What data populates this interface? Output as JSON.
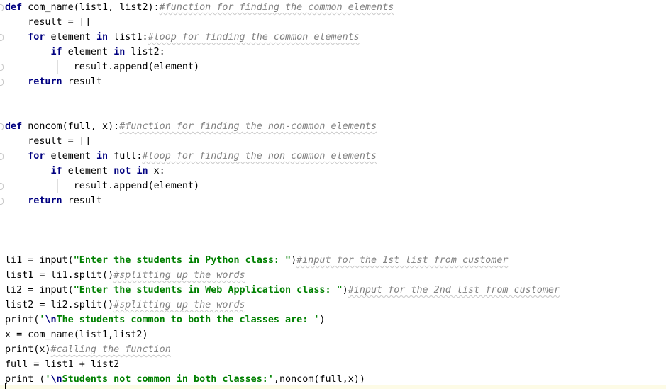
{
  "editor": {
    "language": "python",
    "colors": {
      "keyword": "#000080",
      "string": "#008000",
      "comment": "#808080",
      "text": "#000000",
      "current_line": "#fdfbe6"
    },
    "lines": [
      {
        "indent": 0,
        "tokens": [
          {
            "t": "kw",
            "v": "def"
          },
          {
            "t": "plain",
            "v": " com_name(list1, list2):"
          },
          {
            "t": "cm",
            "v": "#function for finding the common elements"
          }
        ]
      },
      {
        "indent": 1,
        "tokens": [
          {
            "t": "plain",
            "v": "    result = []"
          }
        ]
      },
      {
        "indent": 1,
        "tokens": [
          {
            "t": "plain",
            "v": "    "
          },
          {
            "t": "kw",
            "v": "for"
          },
          {
            "t": "plain",
            "v": " element "
          },
          {
            "t": "kw",
            "v": "in"
          },
          {
            "t": "plain",
            "v": " list1:"
          },
          {
            "t": "cm",
            "v": "#loop for finding the common elements"
          }
        ]
      },
      {
        "indent": 2,
        "tokens": [
          {
            "t": "plain",
            "v": "        "
          },
          {
            "t": "kw",
            "v": "if"
          },
          {
            "t": "plain",
            "v": " element "
          },
          {
            "t": "kw",
            "v": "in"
          },
          {
            "t": "plain",
            "v": " list2:"
          }
        ]
      },
      {
        "indent": 3,
        "tokens": [
          {
            "t": "plain",
            "v": "            result.append(element)"
          }
        ]
      },
      {
        "indent": 1,
        "tokens": [
          {
            "t": "plain",
            "v": "    "
          },
          {
            "t": "kw",
            "v": "return"
          },
          {
            "t": "plain",
            "v": " result"
          }
        ]
      },
      {
        "indent": 0,
        "tokens": []
      },
      {
        "indent": 0,
        "tokens": []
      },
      {
        "indent": 0,
        "tokens": [
          {
            "t": "kw",
            "v": "def"
          },
          {
            "t": "plain",
            "v": " noncom(full, x):"
          },
          {
            "t": "cm",
            "v": "#function for finding the non-common elements"
          }
        ]
      },
      {
        "indent": 1,
        "tokens": [
          {
            "t": "plain",
            "v": "    result = []"
          }
        ]
      },
      {
        "indent": 1,
        "tokens": [
          {
            "t": "plain",
            "v": "    "
          },
          {
            "t": "kw",
            "v": "for"
          },
          {
            "t": "plain",
            "v": " element "
          },
          {
            "t": "kw",
            "v": "in"
          },
          {
            "t": "plain",
            "v": " full:"
          },
          {
            "t": "cm",
            "v": "#loop for finding the non common elements"
          }
        ]
      },
      {
        "indent": 2,
        "tokens": [
          {
            "t": "plain",
            "v": "        "
          },
          {
            "t": "kw",
            "v": "if"
          },
          {
            "t": "plain",
            "v": " element "
          },
          {
            "t": "kw",
            "v": "not"
          },
          {
            "t": "plain",
            "v": " "
          },
          {
            "t": "kw",
            "v": "in"
          },
          {
            "t": "plain",
            "v": " x:"
          }
        ]
      },
      {
        "indent": 3,
        "tokens": [
          {
            "t": "plain",
            "v": "            result.append(element)"
          }
        ]
      },
      {
        "indent": 1,
        "tokens": [
          {
            "t": "plain",
            "v": "    "
          },
          {
            "t": "kw",
            "v": "return"
          },
          {
            "t": "plain",
            "v": " result"
          }
        ]
      },
      {
        "indent": 0,
        "tokens": []
      },
      {
        "indent": 0,
        "tokens": []
      },
      {
        "indent": 0,
        "tokens": []
      },
      {
        "indent": 0,
        "tokens": [
          {
            "t": "plain",
            "v": "li1 = input("
          },
          {
            "t": "st",
            "v": "\"Enter the students in Python class: \""
          },
          {
            "t": "plain",
            "v": ")"
          },
          {
            "t": "cm",
            "v": "#input for the 1st list from customer"
          }
        ]
      },
      {
        "indent": 0,
        "tokens": [
          {
            "t": "plain",
            "v": "list1 = li1.split()"
          },
          {
            "t": "cm",
            "v": "#splitting up the words"
          }
        ]
      },
      {
        "indent": 0,
        "tokens": [
          {
            "t": "plain",
            "v": "li2 = input("
          },
          {
            "t": "st",
            "v": "\"Enter the students in Web Application class: \""
          },
          {
            "t": "plain",
            "v": ")"
          },
          {
            "t": "cm",
            "v": "#input for the 2nd list from customer"
          }
        ]
      },
      {
        "indent": 0,
        "tokens": [
          {
            "t": "plain",
            "v": "list2 = li2.split()"
          },
          {
            "t": "cm",
            "v": "#splitting up the words"
          }
        ]
      },
      {
        "indent": 0,
        "tokens": [
          {
            "t": "plain",
            "v": "print("
          },
          {
            "t": "st",
            "v": "'"
          },
          {
            "t": "esc",
            "v": "\\n"
          },
          {
            "t": "st",
            "v": "The students common to both the classes are: '"
          },
          {
            "t": "plain",
            "v": ")"
          }
        ]
      },
      {
        "indent": 0,
        "tokens": [
          {
            "t": "plain",
            "v": "x = com_name(list1,list2)"
          }
        ]
      },
      {
        "indent": 0,
        "tokens": [
          {
            "t": "plain",
            "v": "print(x)"
          },
          {
            "t": "cm",
            "v": "#calling the function"
          }
        ]
      },
      {
        "indent": 0,
        "tokens": [
          {
            "t": "plain",
            "v": "full = list1 + list2"
          }
        ]
      },
      {
        "indent": 0,
        "tokens": [
          {
            "t": "plain",
            "v": "print ("
          },
          {
            "t": "st",
            "v": "'"
          },
          {
            "t": "esc",
            "v": "\\n"
          },
          {
            "t": "st",
            "v": "Students not common in both classes:'"
          },
          {
            "t": "plain",
            "v": ",noncom(full,x))"
          }
        ]
      }
    ]
  }
}
